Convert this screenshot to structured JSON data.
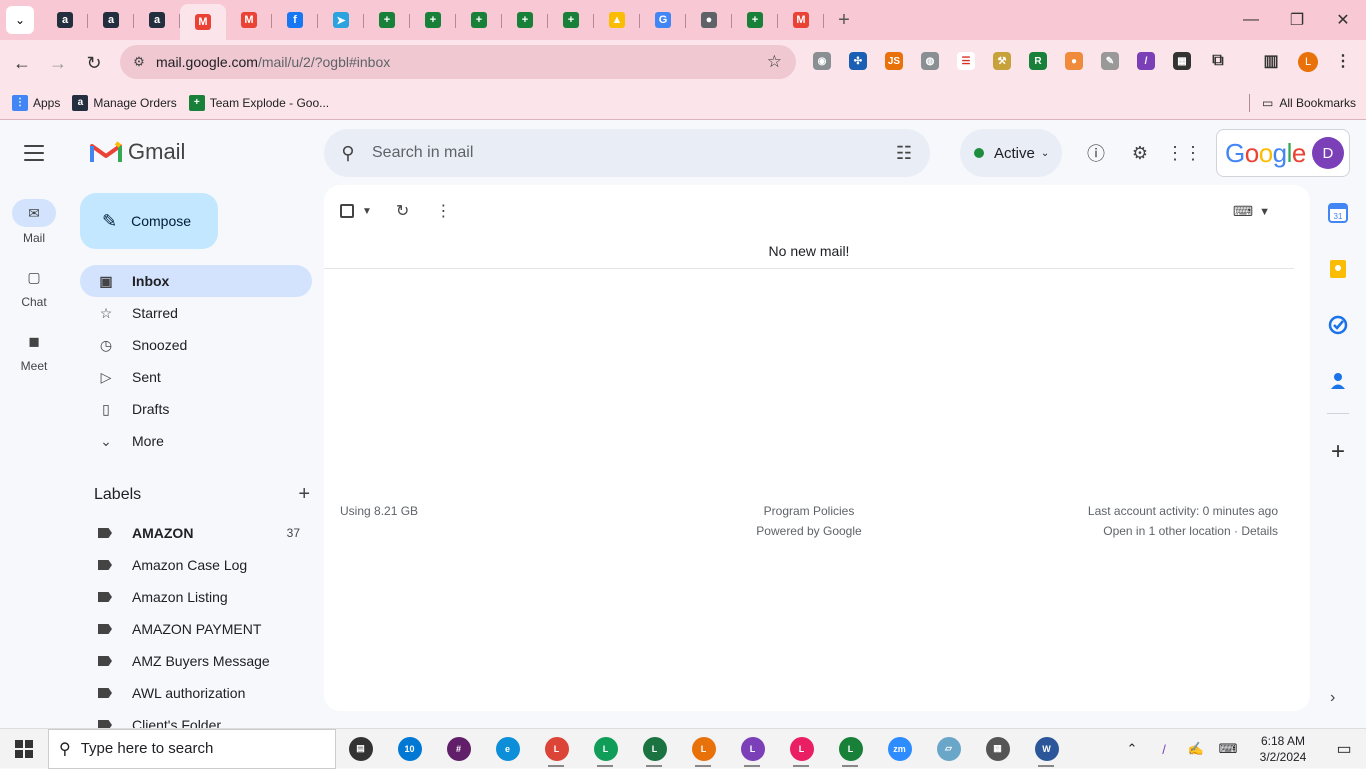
{
  "browser": {
    "tabs": [
      {
        "icon": "amazon-icon",
        "color": "#232f3e",
        "glyph": "a"
      },
      {
        "icon": "amazon-icon",
        "color": "#232f3e",
        "glyph": "a"
      },
      {
        "icon": "amazon-icon",
        "color": "#232f3e",
        "glyph": "a"
      },
      {
        "icon": "gmail-icon",
        "color": "#ea4335",
        "glyph": "M",
        "active": true
      },
      {
        "icon": "gmail-icon",
        "color": "#ea4335",
        "glyph": "M"
      },
      {
        "icon": "facebook-icon",
        "color": "#1877f2",
        "glyph": "f"
      },
      {
        "icon": "telegram-icon",
        "color": "#2aa3df",
        "glyph": "➤"
      },
      {
        "icon": "sheets-icon",
        "color": "#188038",
        "glyph": "+"
      },
      {
        "icon": "sheets-icon",
        "color": "#188038",
        "glyph": "+"
      },
      {
        "icon": "sheets-icon",
        "color": "#188038",
        "glyph": "+"
      },
      {
        "icon": "sheets-icon",
        "color": "#188038",
        "glyph": "+"
      },
      {
        "icon": "sheets-icon",
        "color": "#188038",
        "glyph": "+"
      },
      {
        "icon": "drive-icon",
        "color": "#fbbc04",
        "glyph": "▲"
      },
      {
        "icon": "google-icon",
        "color": "#4285f4",
        "glyph": "G"
      },
      {
        "icon": "globe-icon",
        "color": "#5f6368",
        "glyph": "●"
      },
      {
        "icon": "sheets-icon",
        "color": "#188038",
        "glyph": "+"
      },
      {
        "icon": "gmail-icon",
        "color": "#ea4335",
        "glyph": "M"
      }
    ],
    "new_tab": "+",
    "url_host": "mail.google.com",
    "url_path": "/mail/u/2/?ogbl#inbox",
    "profile_initial": "L",
    "bookmarks": [
      {
        "label": "Apps",
        "icon": "apps-grid-icon",
        "color": "#4285f4",
        "glyph": "⋮"
      },
      {
        "label": "Manage Orders",
        "icon": "amazon-icon",
        "color": "#232f3e",
        "glyph": "a"
      },
      {
        "label": "Team Explode - Goo...",
        "icon": "sheets-icon",
        "color": "#188038",
        "glyph": "+"
      }
    ],
    "all_bookmarks": "All Bookmarks"
  },
  "gmail": {
    "brand": "Gmail",
    "search_placeholder": "Search in mail",
    "status": {
      "label": "Active",
      "color": "#1e8e3e"
    },
    "account_brand": "Google",
    "account_initial": "D",
    "rail": [
      {
        "label": "Mail",
        "icon": "mail-icon",
        "glyph": "✉",
        "active": true
      },
      {
        "label": "Chat",
        "icon": "chat-icon",
        "glyph": "▢"
      },
      {
        "label": "Meet",
        "icon": "meet-icon",
        "glyph": "◼"
      }
    ],
    "compose_label": "Compose",
    "nav": [
      {
        "label": "Inbox",
        "icon": "inbox-icon",
        "glyph": "▣",
        "active": true
      },
      {
        "label": "Starred",
        "icon": "star-icon",
        "glyph": "☆"
      },
      {
        "label": "Snoozed",
        "icon": "clock-icon",
        "glyph": "◷"
      },
      {
        "label": "Sent",
        "icon": "send-icon",
        "glyph": "▷"
      },
      {
        "label": "Drafts",
        "icon": "draft-icon",
        "glyph": "▯"
      },
      {
        "label": "More",
        "icon": "chevron-down-icon",
        "glyph": "⌄"
      }
    ],
    "labels_title": "Labels",
    "labels": [
      {
        "label": "AMAZON",
        "count": "37",
        "bold": true
      },
      {
        "label": "Amazon Case Log",
        "count": ""
      },
      {
        "label": "Amazon Listing",
        "count": ""
      },
      {
        "label": "AMAZON PAYMENT",
        "count": ""
      },
      {
        "label": "AMZ Buyers Message",
        "count": ""
      },
      {
        "label": "AWL authorization",
        "count": ""
      },
      {
        "label": "Client's Folder",
        "count": ""
      }
    ],
    "empty_message": "No new mail!",
    "storage": "Using 8.21 GB",
    "policies": "Program Policies",
    "powered": "Powered by Google",
    "last_activity": "Last account activity: 0 minutes ago",
    "other_location": "Open in 1 other location · Details"
  },
  "taskbar": {
    "search_placeholder": "Type here to search",
    "time": "6:18 AM",
    "date": "3/2/2024",
    "apps": [
      {
        "icon": "task-view-icon",
        "color": "#333333",
        "glyph": "▤"
      },
      {
        "icon": "clock-app-icon",
        "color": "#0078d4",
        "glyph": "10"
      },
      {
        "icon": "slack-icon",
        "color": "#611f69",
        "glyph": "#"
      },
      {
        "icon": "edge-icon",
        "color": "#0c8ed9",
        "glyph": "e"
      },
      {
        "icon": "chrome-icon",
        "color": "#db4437",
        "glyph": "L"
      },
      {
        "icon": "chrome-icon",
        "color": "#0f9d58",
        "glyph": "L"
      },
      {
        "icon": "chrome-icon",
        "color": "#1a7340",
        "glyph": "L"
      },
      {
        "icon": "chrome-icon",
        "color": "#e8710a",
        "glyph": "L"
      },
      {
        "icon": "chrome-icon",
        "color": "#7b3fb8",
        "glyph": "L"
      },
      {
        "icon": "chrome-icon",
        "color": "#e91e63",
        "glyph": "L"
      },
      {
        "icon": "chrome-icon",
        "color": "#188038",
        "glyph": "L"
      },
      {
        "icon": "zoom-icon",
        "color": "#2d8cff",
        "glyph": "zm"
      },
      {
        "icon": "notepad-icon",
        "color": "#6aa6c8",
        "glyph": "▱"
      },
      {
        "icon": "calculator-icon",
        "color": "#555555",
        "glyph": "▦"
      },
      {
        "icon": "word-icon",
        "color": "#2b579a",
        "glyph": "W"
      }
    ]
  }
}
